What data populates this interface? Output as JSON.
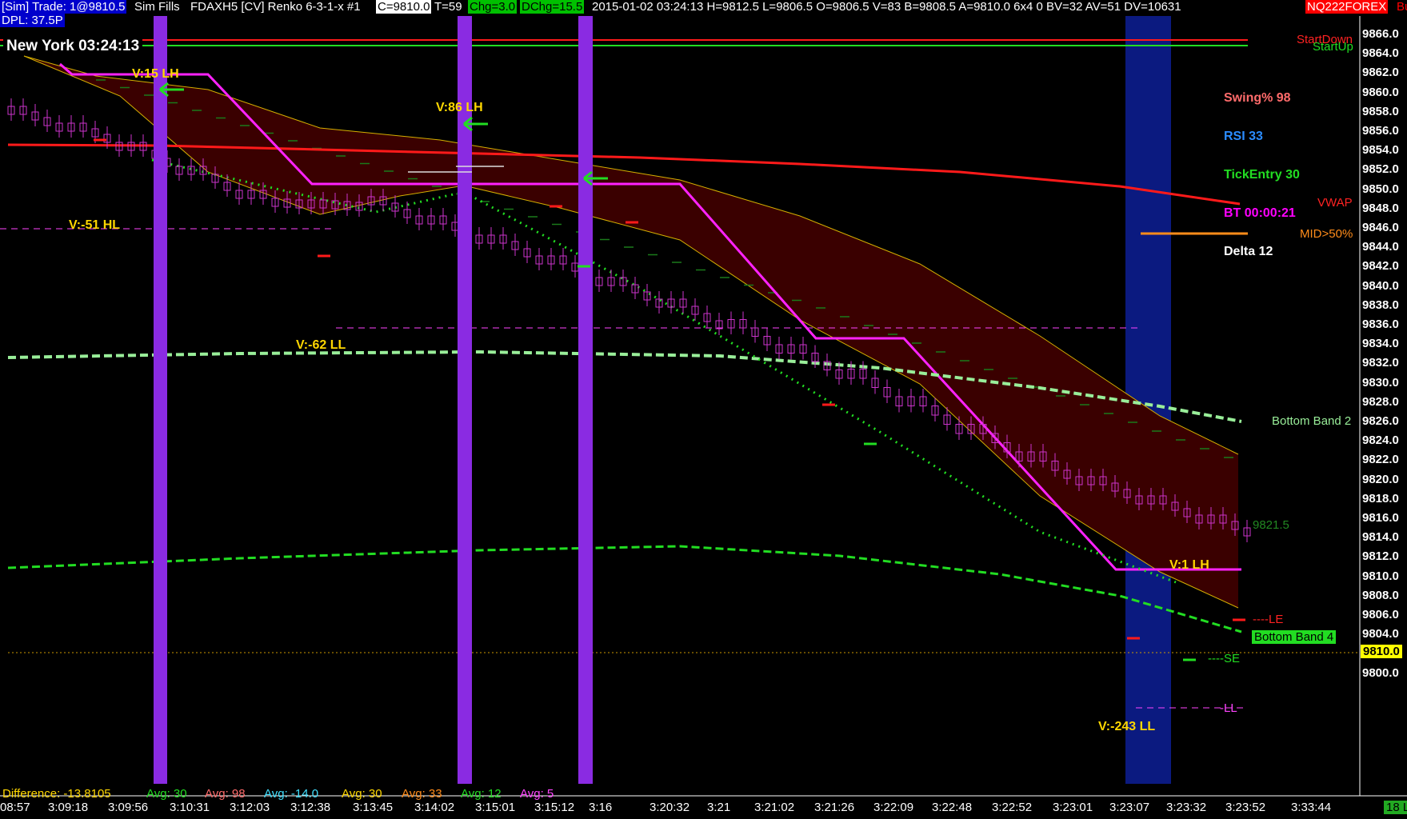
{
  "header": {
    "cells": [
      {
        "text": "[Sim]  Trade: 1@9810.5",
        "bg": "#0000cc",
        "fg": "#ffffff"
      },
      {
        "text": "Sim Fills",
        "bg": "#000000",
        "fg": "#ffffff"
      },
      {
        "text": "FDAXH5 [CV]  Renko 6-3-1-x  #1",
        "bg": "#000000",
        "fg": "#ffffff"
      },
      {
        "text": "C=9810.0",
        "bg": "#ffffff",
        "fg": "#000000"
      },
      {
        "text": "T=59",
        "bg": "#000000",
        "fg": "#ffffff"
      },
      {
        "text": "Chg=3.0",
        "bg": "#00c000",
        "fg": "#000000"
      },
      {
        "text": "DChg=15.5",
        "bg": "#00c000",
        "fg": "#000000"
      },
      {
        "text": "2015-01-02 03:24:13 H=9812.5 L=9806.5 O=9806.5 V=83 B=9808.5 A=9810.0 6x4 0 BV=32 AV=51 DV=10631",
        "bg": "#000000",
        "fg": "#ffffff"
      },
      {
        "text": "NQ222FOREX",
        "bg": "#ff0000",
        "fg": "#ffffff"
      },
      {
        "text": "Buy E",
        "bg": "#000000",
        "fg": "#ff0000"
      }
    ],
    "dpl": "DPL: 37.5P"
  },
  "clock": "New York 03:24:13",
  "price_axis": [
    "9866.0",
    "9864.0",
    "9862.0",
    "9860.0",
    "9858.0",
    "9856.0",
    "9854.0",
    "9852.0",
    "9850.0",
    "9848.0",
    "9846.0",
    "9844.0",
    "9842.0",
    "9840.0",
    "9838.0",
    "9836.0",
    "9834.0",
    "9832.0",
    "9830.0",
    "9828.0",
    "9826.0",
    "9824.0",
    "9822.0",
    "9820.0",
    "9818.0",
    "9816.0",
    "9814.0",
    "9812.0",
    "9810.0",
    "9808.0",
    "9806.0",
    "9804.0",
    "9802.0",
    "9800.0"
  ],
  "current_price": "9810.0",
  "time_axis": [
    "08:57",
    "3:09:18",
    "3:09:56",
    "3:10:31",
    "3:12:03",
    "3:12:38",
    "3:13:45",
    "3:14:02",
    "3:15:01",
    "3:15:12",
    "3:16",
    "3:20:32",
    "3:21",
    "3:21:02",
    "3:21:26",
    "3:22:09",
    "3:22:48",
    "3:22:52",
    "3:23:01",
    "3:23:07",
    "3:23:32",
    "3:23:52",
    "3:33:44"
  ],
  "corner_badge": "18 L",
  "swing_labels": [
    {
      "text": "V:15 LH",
      "color": "#ffd700"
    },
    {
      "text": "V:86 LH",
      "color": "#ffd700"
    },
    {
      "text": "V:-51 HL",
      "color": "#ffd700"
    },
    {
      "text": "V:-62 LL",
      "color": "#ffd700"
    },
    {
      "text": "V:1 LH",
      "color": "#ffd700"
    },
    {
      "text": "V:-243 LL",
      "color": "#ffd700"
    }
  ],
  "stats_panel": [
    {
      "text": "Swing% 98",
      "color": "#ff6b6b"
    },
    {
      "text": "RSI 33",
      "color": "#2b8cff"
    },
    {
      "text": "TickEntry 30",
      "color": "#22dd22"
    },
    {
      "text": "BT 00:00:21",
      "color": "#ff00ff"
    },
    {
      "text": "Delta 12",
      "color": "#ffffff"
    }
  ],
  "right_tags": {
    "start_down": "StartDown",
    "start_up": "StartUp",
    "vwap": "VWAP",
    "mid": "MID>50%",
    "bottom_band_2": "Bottom Band 2",
    "price_9821": "9821.5",
    "le": "----LE",
    "bottom_band_4": "Bottom Band 4",
    "se": "----SE",
    "ll": "-LL"
  },
  "bottom_stats": [
    {
      "text": "Difference: -13.8105",
      "color": "#ffd700"
    },
    {
      "text": "Avg: 30",
      "color": "#22dd22"
    },
    {
      "text": "Avg: 98",
      "color": "#ff6b6b"
    },
    {
      "text": "Avg: -14.0",
      "color": "#40e0ff"
    },
    {
      "text": "Avg: 30",
      "color": "#ffd700"
    },
    {
      "text": "Avg: 33",
      "color": "#ff8c1a"
    },
    {
      "text": "Avg: 12",
      "color": "#22dd22"
    },
    {
      "text": "Avg: 5",
      "color": "#ff44ff"
    }
  ],
  "colors": {
    "candle": "#cc33cc",
    "band_fill": "#3a0000",
    "band_edge": "#d4b000",
    "vwap": "#ff1a1a",
    "magenta_line": "#ff22ff",
    "session_bar": "#8a2be2",
    "session_bar_dark": "#0b1a80",
    "green_dashed": "#22dd22",
    "light_green_dashed": "#99ee99"
  }
}
